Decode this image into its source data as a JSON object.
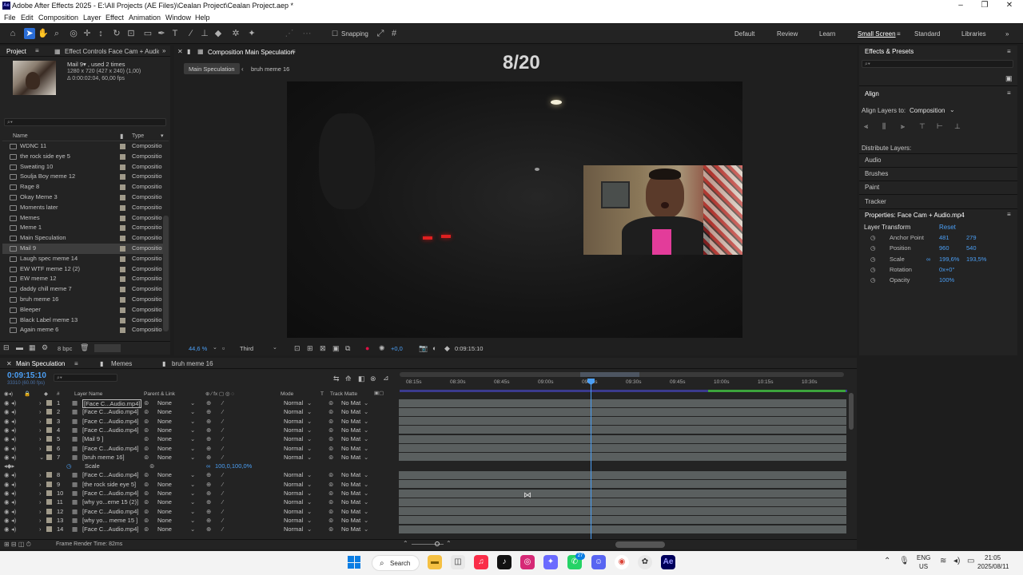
{
  "window": {
    "title": "Adobe After Effects 2025 - E:\\All Projects (AE Files)\\Cealan Project\\Cealan Project.aep *",
    "app_badge": "Ae"
  },
  "menu": [
    "File",
    "Edit",
    "Composition",
    "Layer",
    "Effect",
    "Animation",
    "Window",
    "Help"
  ],
  "toolbar": {
    "snapping_label": "Snapping",
    "workspaces": [
      "Default",
      "Review",
      "Learn",
      "Small Screen",
      "Standard",
      "Libraries"
    ],
    "active_workspace": "Small Screen"
  },
  "project_panel": {
    "tab_project": "Project",
    "tab_effects": "Effect Controls Face Cam + Audio.mp",
    "selected_name": "Mail 9▾ , used 2 times",
    "selected_dims": "1280 x 720  (427 x 240) (1,00)",
    "selected_dur": "Δ 0:00:02:04, 60,00 fps",
    "col_name": "Name",
    "col_type": "Type",
    "items": [
      {
        "name": "WDNC 11",
        "type": "Compositio"
      },
      {
        "name": "the rock side eye 5",
        "type": "Compositio"
      },
      {
        "name": "Sweating 10",
        "type": "Compositio"
      },
      {
        "name": "Soulja Boy meme 12",
        "type": "Compositio"
      },
      {
        "name": "Rage 8",
        "type": "Compositio"
      },
      {
        "name": "Okay Meme 3",
        "type": "Compositio"
      },
      {
        "name": "Moments later",
        "type": "Compositio"
      },
      {
        "name": "Memes",
        "type": "Compositio"
      },
      {
        "name": "Meme 1",
        "type": "Compositio"
      },
      {
        "name": "Main Speculation",
        "type": "Compositio"
      },
      {
        "name": "Mail 9",
        "type": "Compositio"
      },
      {
        "name": "Laugh spec meme 14",
        "type": "Compositio"
      },
      {
        "name": "EW WTF meme 12 (2)",
        "type": "Compositio"
      },
      {
        "name": "EW meme 12",
        "type": "Compositio"
      },
      {
        "name": "daddy chill meme 7",
        "type": "Compositio"
      },
      {
        "name": "bruh meme 16",
        "type": "Compositio"
      },
      {
        "name": "Bleeper",
        "type": "Compositio"
      },
      {
        "name": "Black Label meme 13",
        "type": "Compositio"
      },
      {
        "name": "Again meme 6",
        "type": "Compositio"
      }
    ],
    "selected_index": 10,
    "bpc": "8 bpc"
  },
  "composition": {
    "tab": "Composition Main Speculation",
    "breadcrumb_main": "Main Speculation",
    "breadcrumb_sub": "bruh meme 16",
    "overlay_text": "8/20",
    "zoom": "44,6 %",
    "resolution": "Third",
    "exposure": "+0,0",
    "timecode": "0:09:15:10"
  },
  "right_panel": {
    "effects_title": "Effects & Presets",
    "align_title": "Align",
    "align_to_label": "Align Layers to:",
    "align_to_value": "Composition",
    "distribute_label": "Distribute Layers:",
    "sections": [
      "Audio",
      "Brushes",
      "Paint",
      "Tracker"
    ],
    "properties_title": "Properties: Face Cam + Audio.mp4",
    "layer_transform": "Layer Transform",
    "reset": "Reset",
    "props": [
      {
        "name": "Anchor Point",
        "v1": "481",
        "v2": "279"
      },
      {
        "name": "Position",
        "v1": "960",
        "v2": "540"
      },
      {
        "name": "Scale",
        "v1": "199,6%",
        "v2": "193,5%"
      },
      {
        "name": "Rotation",
        "v1": "0x+0°",
        "v2": ""
      },
      {
        "name": "Opacity",
        "v1": "100%",
        "v2": ""
      }
    ]
  },
  "timeline": {
    "tabs": [
      "Main Speculation",
      "Memes",
      "bruh meme 16"
    ],
    "timecode": "0:09:15:10",
    "frames": "33310 (60.00 fps)",
    "ruler": [
      "08:15s",
      "08:30s",
      "08:45s",
      "09:00s",
      "09:15s",
      "09:30s",
      "09:45s",
      "10:00s",
      "10:15s",
      "10:30s"
    ],
    "headers": {
      "num": "#",
      "layer": "Layer Name",
      "parent": "Parent & Link",
      "mode": "Mode",
      "t": "T",
      "matte": "Track Matte"
    },
    "layers": [
      {
        "num": "1",
        "name": "[Face C...Audio.mp4]",
        "parent": "None",
        "mode": "Normal",
        "matte": "No Mat"
      },
      {
        "num": "2",
        "name": "[Face C...Audio.mp4]",
        "parent": "None",
        "mode": "Normal",
        "matte": "No Mat"
      },
      {
        "num": "3",
        "name": "[Face C...Audio.mp4]",
        "parent": "None",
        "mode": "Normal",
        "matte": "No Mat"
      },
      {
        "num": "4",
        "name": "[Face C...Audio.mp4]",
        "parent": "None",
        "mode": "Normal",
        "matte": "No Mat"
      },
      {
        "num": "5",
        "name": "[Mail 9 ]",
        "parent": "None",
        "mode": "Normal",
        "matte": "No Mat"
      },
      {
        "num": "6",
        "name": "[Face C...Audio.mp4]",
        "parent": "None",
        "mode": "Normal",
        "matte": "No Mat"
      },
      {
        "num": "7",
        "name": "[bruh meme 16]",
        "parent": "None",
        "mode": "Normal",
        "matte": "No Mat"
      },
      {
        "num": "8",
        "name": "[Face C...Audio.mp4]",
        "parent": "None",
        "mode": "Normal",
        "matte": "No Mat"
      },
      {
        "num": "9",
        "name": "[the rock side eye 5]",
        "parent": "None",
        "mode": "Normal",
        "matte": "No Mat"
      },
      {
        "num": "10",
        "name": "[Face C...Audio.mp4]",
        "parent": "None",
        "mode": "Normal",
        "matte": "No Mat"
      },
      {
        "num": "11",
        "name": "[why yo...eme 15 (2)]",
        "parent": "None",
        "mode": "Normal",
        "matte": "No Mat"
      },
      {
        "num": "12",
        "name": "[Face C...Audio.mp4]",
        "parent": "None",
        "mode": "Normal",
        "matte": "No Mat"
      },
      {
        "num": "13",
        "name": "[why yo... meme 15 ]",
        "parent": "None",
        "mode": "Normal",
        "matte": "No Mat"
      },
      {
        "num": "14",
        "name": "[Face C...Audio.mp4]",
        "parent": "None",
        "mode": "Normal",
        "matte": "No Mat"
      }
    ],
    "scale_label": "Scale",
    "scale_value": "100,0,100,0%",
    "render_time": "Frame Render Time: 82ms"
  },
  "taskbar": {
    "search": "Search",
    "lang": "ENG",
    "region": "US",
    "time": "21:05",
    "date": "2025/08/11",
    "badge": "27"
  },
  "colors": {
    "accent": "#2d8ceb",
    "playhead": "#4b9ff5",
    "label": "#a09a8a",
    "track": "#5a5f5f"
  }
}
